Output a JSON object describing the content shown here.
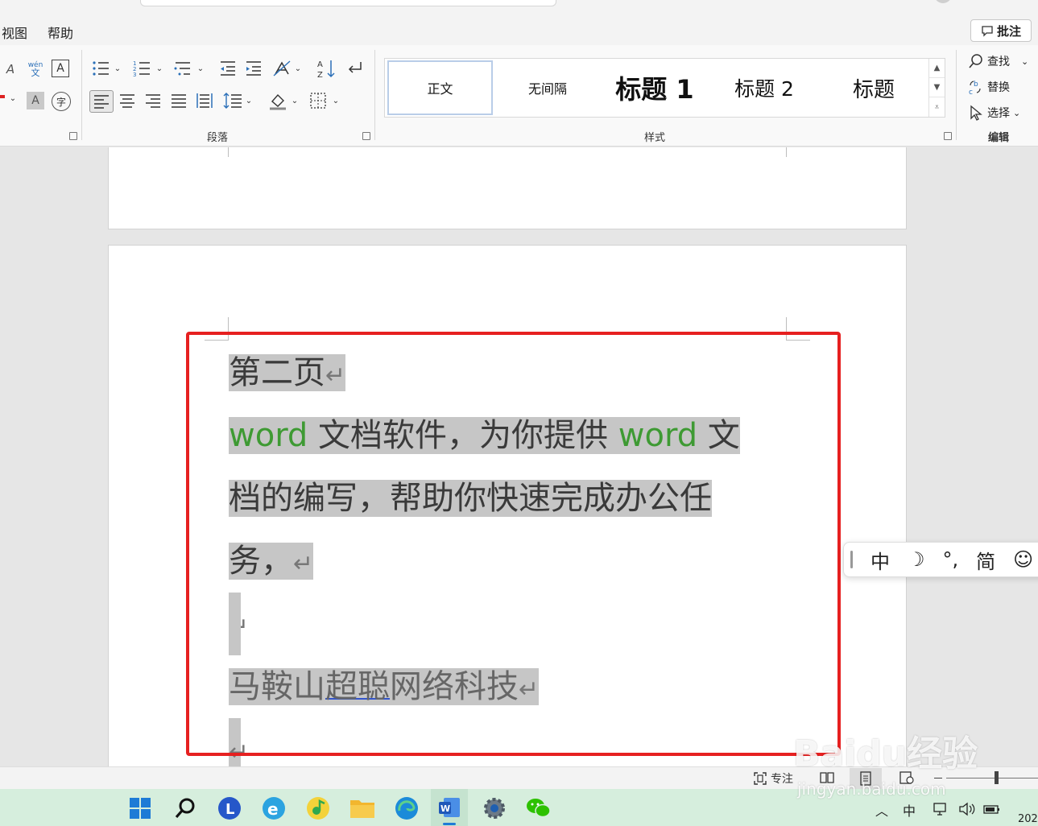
{
  "menu": {
    "view": "视图",
    "help": "帮助",
    "comment": "批注"
  },
  "ribbon": {
    "font_row1": [
      "wén",
      "文"
    ],
    "paragraph_label": "段落",
    "styles_label": "样式",
    "editing_label": "编辑",
    "styles": [
      {
        "label": "正文",
        "selected": true
      },
      {
        "label": "无间隔",
        "selected": false
      },
      {
        "label": "标题 1",
        "selected": false
      },
      {
        "label": "标题 2",
        "selected": false
      },
      {
        "label": "标题",
        "selected": false
      }
    ],
    "find": "查找",
    "replace": "替换",
    "select": "选择"
  },
  "document": {
    "line1": "第二页",
    "line2_a": "word",
    "line2_b": " 文档软件，为你提供 ",
    "line2_c": "word",
    "line2_d": " 文",
    "line3": "档的编写，帮助你快速完成办公任",
    "line4": "务，",
    "line6_a": "马鞍山",
    "line6_b": "超聪",
    "line6_c": "网络科技",
    "para_mark": "↵"
  },
  "ime": {
    "mode": "中",
    "moon": "☽",
    "punct": "°,",
    "simplified": "简",
    "emoji": "☺"
  },
  "status": {
    "focus": "专注"
  },
  "taskbar": {
    "tray_lang": "中",
    "clock": "202"
  },
  "watermark": {
    "main": "Baidu经验",
    "sub": "jingyan.baidu.com"
  },
  "colors": {
    "accent_green": "#3e9a33",
    "selection": "#c6c6c6",
    "highlight_box": "#e62020"
  }
}
